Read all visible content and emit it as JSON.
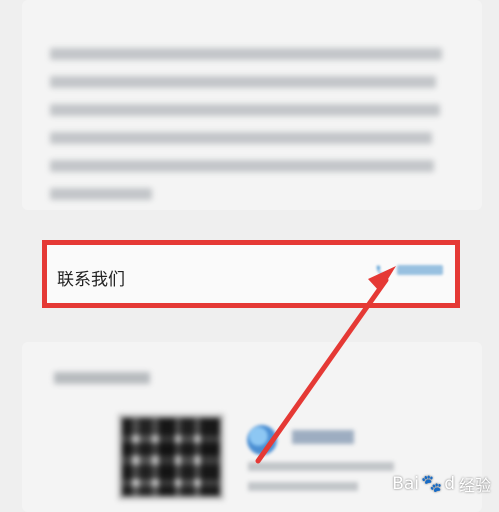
{
  "contact": {
    "label": "联系我们",
    "phone_icon": "phone-icon"
  },
  "watermark": {
    "brand": "Bai",
    "paw": "🐾",
    "brand2": "d",
    "cn": "经验"
  },
  "colors": {
    "highlight_red": "#e53935",
    "phone_blue": "#5aa0d6",
    "background": "#efefef"
  }
}
